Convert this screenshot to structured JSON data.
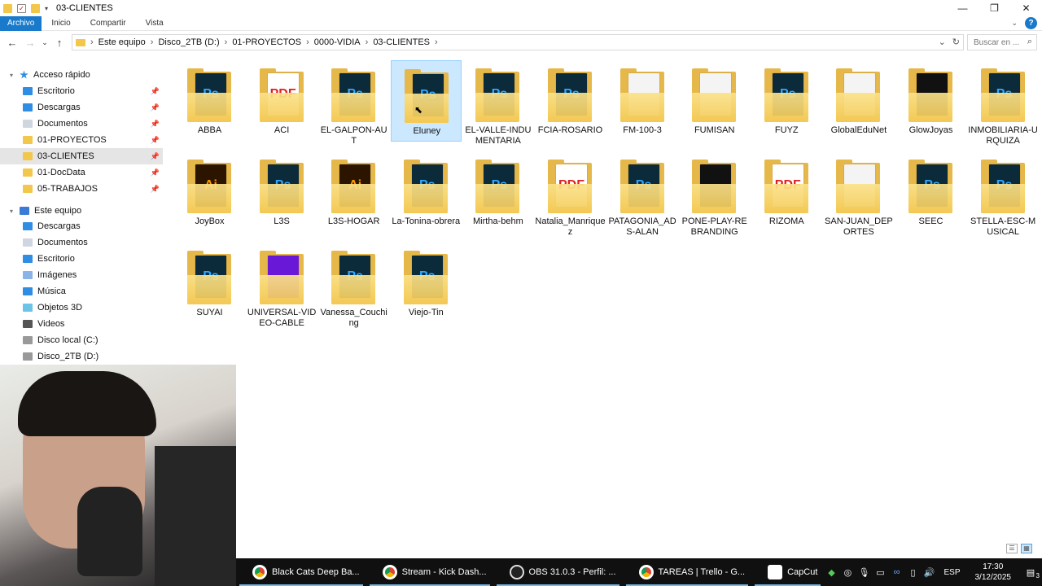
{
  "window": {
    "title": "03-CLIENTES",
    "controls": [
      "minimize",
      "maximize",
      "close"
    ]
  },
  "ribbon": {
    "tabs": [
      "Archivo",
      "Inicio",
      "Compartir",
      "Vista"
    ]
  },
  "address": {
    "crumbs": [
      "Este equipo",
      "Disco_2TB (D:)",
      "01-PROYECTOS",
      "0000-VIDIA",
      "03-CLIENTES"
    ],
    "search_placeholder": "Buscar en ..."
  },
  "sidebar": {
    "quick_access": "Acceso rápido",
    "quick_items": [
      {
        "label": "Escritorio",
        "icon": "desktop-icon"
      },
      {
        "label": "Descargas",
        "icon": "download-icon"
      },
      {
        "label": "Documentos",
        "icon": "documents-icon"
      },
      {
        "label": "01-PROYECTOS",
        "icon": "folder-icon"
      },
      {
        "label": "03-CLIENTES",
        "icon": "folder-icon",
        "selected": true
      },
      {
        "label": "01-DocData",
        "icon": "folder-icon"
      },
      {
        "label": "05-TRABAJOS",
        "icon": "folder-icon"
      }
    ],
    "this_pc": "Este equipo",
    "pc_items": [
      {
        "label": "Descargas",
        "icon": "download-icon"
      },
      {
        "label": "Documentos",
        "icon": "documents-icon"
      },
      {
        "label": "Escritorio",
        "icon": "desktop-icon"
      },
      {
        "label": "Imágenes",
        "icon": "pictures-icon"
      },
      {
        "label": "Música",
        "icon": "music-icon"
      },
      {
        "label": "Objetos 3D",
        "icon": "3d-objects-icon"
      },
      {
        "label": "Videos",
        "icon": "videos-icon"
      },
      {
        "label": "Disco local (C:)",
        "icon": "drive-icon"
      },
      {
        "label": "Disco_2TB (D:)",
        "icon": "drive-icon"
      }
    ]
  },
  "folders": [
    {
      "name": "ABBA",
      "preview": "ps"
    },
    {
      "name": "ACI",
      "preview": "pdf"
    },
    {
      "name": "EL-GALPON-AUT",
      "preview": "ps"
    },
    {
      "name": "Eluney",
      "preview": "ps",
      "selected": true
    },
    {
      "name": "EL-VALLE-INDUMENTARIA",
      "preview": "ps"
    },
    {
      "name": "FCIA-ROSARIO",
      "preview": "ps"
    },
    {
      "name": "FM-100-3",
      "preview": "white"
    },
    {
      "name": "FUMISAN",
      "preview": "white"
    },
    {
      "name": "FUYZ",
      "preview": "ps"
    },
    {
      "name": "GlobalEduNet",
      "preview": "white"
    },
    {
      "name": "GlowJoyas",
      "preview": "black"
    },
    {
      "name": "INMOBILIARIA-URQUIZA",
      "preview": "ps"
    },
    {
      "name": "JoyBox",
      "preview": "ai"
    },
    {
      "name": "L3S",
      "preview": "ps"
    },
    {
      "name": "L3S-HOGAR",
      "preview": "ai"
    },
    {
      "name": "La-Tonina-obrera",
      "preview": "ps"
    },
    {
      "name": "Mirtha-behm",
      "preview": "ps"
    },
    {
      "name": "Natalia_Manriquez",
      "preview": "pdf"
    },
    {
      "name": "PATAGONIA_ADS-ALAN",
      "preview": "ps"
    },
    {
      "name": "PONE-PLAY-REBRANDING",
      "preview": "black"
    },
    {
      "name": "RIZOMA",
      "preview": "pdf"
    },
    {
      "name": "SAN-JUAN_DEPORTES",
      "preview": "white"
    },
    {
      "name": "SEEC",
      "preview": "ps"
    },
    {
      "name": "STELLA-ESC-MUSICAL",
      "preview": "ps"
    },
    {
      "name": "SUYAI",
      "preview": "ps"
    },
    {
      "name": "UNIVERSAL-VIDEO-CABLE",
      "preview": "purple"
    },
    {
      "name": "Vanessa_Couching",
      "preview": "ps"
    },
    {
      "name": "Viejo-Tin",
      "preview": "ps"
    }
  ],
  "preview_glyphs": {
    "ps": "Ps",
    "pdf": "PDF",
    "ai": "Ai",
    "purple": "",
    "black": "",
    "white": ""
  },
  "taskbar": {
    "tasks": [
      {
        "label": "Black Cats Deep Ba...",
        "icon": "chrome-icon"
      },
      {
        "label": "Stream - Kick Dash...",
        "icon": "chrome-icon"
      },
      {
        "label": "OBS 31.0.3 - Perfil: ...",
        "icon": "obs-icon"
      },
      {
        "label": "TAREAS | Trello - G...",
        "icon": "chrome-icon"
      },
      {
        "label": "CapCut",
        "icon": "capcut-icon"
      }
    ],
    "language": "ESP",
    "time": "17:30",
    "date": "3/12/2025",
    "notification_count": "3"
  }
}
